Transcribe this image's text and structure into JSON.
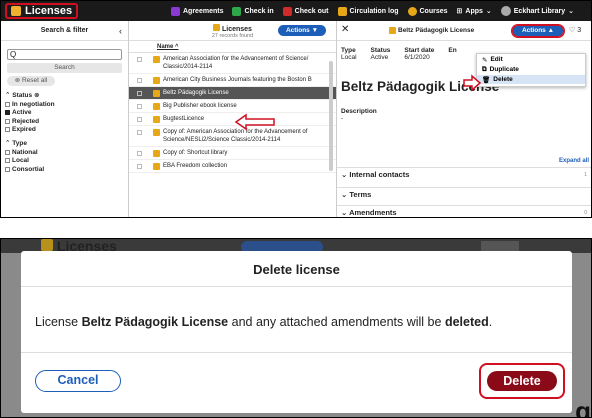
{
  "top": {
    "app_title": "Licenses",
    "nav": [
      "Agreements",
      "Check in",
      "Check out",
      "Circulation log",
      "Courses",
      "Apps",
      "Eckhart Library"
    ],
    "filter": {
      "header": "Search & filter",
      "search_placeholder": "Q",
      "search_button": "Search",
      "reset_button": "Reset all",
      "status_label": "Status",
      "status_options": [
        "In negotiation",
        "Active",
        "Rejected",
        "Expired"
      ],
      "type_label": "Type",
      "type_options": [
        "National",
        "Local",
        "Consortial"
      ]
    },
    "list": {
      "title": "Licenses",
      "subtitle": "27 records found",
      "actions_label": "Actions ▼",
      "column_name": "Name ^",
      "rows": [
        "American Association for the Advancement of Science/ Classic/2014-2114",
        "American City Business Journals featuring the Boston B",
        "Beltz Pädagogik License",
        "Big Publisher ebook license",
        "BugtestLicence",
        "Copy of: American Association for the Advancement of Science/NESLi2/Science Classic/2014-2114",
        "Copy of: Shortcut library",
        "EBA Freedom collection"
      ]
    },
    "detail": {
      "header_title": "Beltz Pädagogik License",
      "actions_label": "Actions ▲",
      "type_key": "Type",
      "type_val": "Local",
      "status_key": "Status",
      "status_val": "Active",
      "start_key": "Start date",
      "start_val": "6/1/2020",
      "end_key": "En",
      "title": "Beltz Pädagogik License",
      "description_label": "Description",
      "description_val": "-",
      "expand_all": "Expand all",
      "sections": [
        "Internal contacts",
        "Terms",
        "Amendments"
      ],
      "internal_contacts_count": "1",
      "amendments_count": "0"
    },
    "menu": {
      "items": [
        "Edit",
        "Duplicate",
        "Delete"
      ]
    }
  },
  "bottom": {
    "bg_title": "Licenses",
    "dialog_title": "Delete license",
    "body_prefix": "License ",
    "body_name": "Beltz Pädagogik License",
    "body_mid": " and any attached amendments will be ",
    "body_bold_end": "deleted",
    "body_suffix": ".",
    "cancel": "Cancel",
    "delete": "Delete"
  },
  "colors": {
    "accent": "#1d5fb8",
    "highlight": "#d01020",
    "delete_btn": "#8b0a18"
  }
}
